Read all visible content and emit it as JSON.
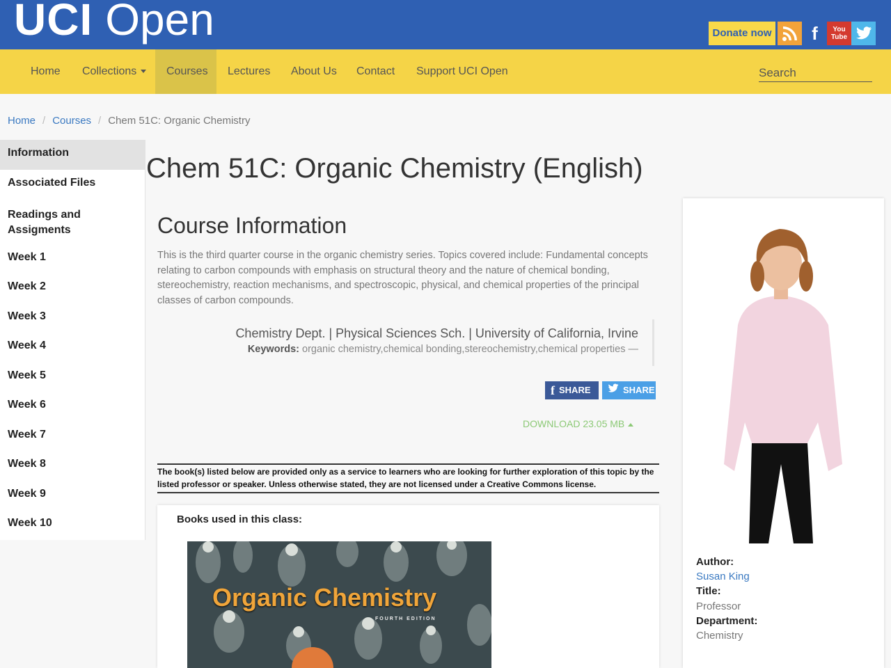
{
  "brand": {
    "uci": "UCI",
    "open": "Open"
  },
  "header": {
    "donate_label": "Donate now",
    "social": [
      "rss-icon",
      "facebook-icon",
      "youtube-icon",
      "twitter-icon"
    ],
    "youtube_text": "You Tube"
  },
  "nav": {
    "items": [
      "Home",
      "Collections",
      "Courses",
      "Lectures",
      "About Us",
      "Contact",
      "Support UCI Open"
    ],
    "active": "Courses",
    "search_placeholder": "Search"
  },
  "breadcrumb": {
    "home": "Home",
    "courses": "Courses",
    "current": "Chem 51C: Organic Chemistry",
    "separator": "/"
  },
  "sidebar": {
    "items": [
      "Information",
      "Associated Files",
      "Readings and Assigments",
      "Week 1",
      "Week 2",
      "Week 3",
      "Week 4",
      "Week 5",
      "Week 6",
      "Week 7",
      "Week 8",
      "Week 9",
      "Week 10"
    ],
    "active": "Information"
  },
  "page": {
    "title": "Chem 51C: Organic Chemistry (English)",
    "section_title": "Course Information",
    "description": "This is the third quarter course in the organic chemistry series. Topics covered include: Fundamental concepts relating to carbon compounds with emphasis on structural theory and the nature of chemical bonding, stereochemistry, reaction mechanisms, and spectroscopic, physical, and chemical properties of the principal classes of carbon compounds.",
    "attribution": "Chemistry Dept. | Physical Sciences Sch. | University of California, Irvine",
    "keywords_label": "Keywords:",
    "keywords": "organic chemistry,chemical bonding,stereochemistry,chemical properties —",
    "share_fb": "SHARE",
    "share_tw": "SHARE",
    "download": "DOWNLOAD 23.05 MB",
    "notice": "The book(s) listed below are provided only as a service to learners who are looking for further exploration of this topic by the listed professor or speaker. Unless otherwise stated, they are not licensed under a Creative Commons license.",
    "books_heading": "Books used in this class:",
    "book_title": "Organic Chemistry",
    "book_edition": "FOURTH EDITION"
  },
  "author": {
    "author_label": "Author:",
    "author_name": "Susan King",
    "title_label": "Title:",
    "title_value": "Professor",
    "department_label": "Department:",
    "department_value": "Chemistry"
  },
  "colors": {
    "topbar": "#2f60b3",
    "navbar": "#f5d447",
    "nav_active": "#dac349",
    "link": "#3a79c1",
    "download": "#8cc976"
  }
}
